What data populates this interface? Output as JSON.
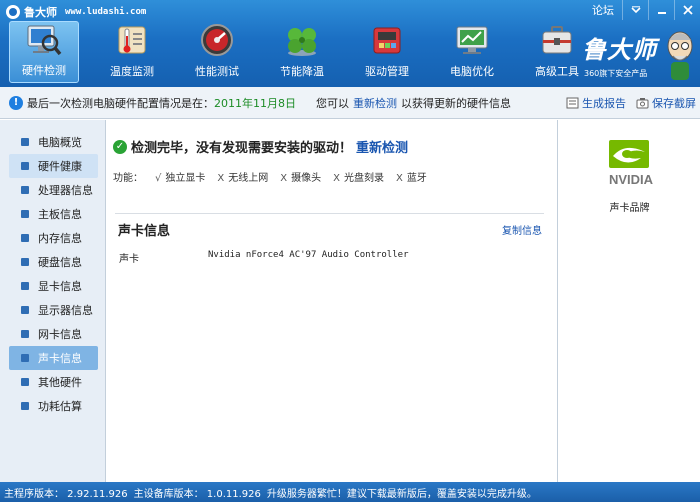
{
  "window": {
    "app_name": "鲁大师",
    "url": "www.ludashi.com",
    "forum_label": "论坛"
  },
  "toolbar": {
    "items": [
      {
        "label": "硬件检测",
        "icon": "hardware-detect-icon"
      },
      {
        "label": "温度监测",
        "icon": "thermometer-icon"
      },
      {
        "label": "性能测试",
        "icon": "speedometer-icon"
      },
      {
        "label": "节能降温",
        "icon": "clover-icon"
      },
      {
        "label": "驱动管理",
        "icon": "driver-toolbox-icon"
      },
      {
        "label": "电脑优化",
        "icon": "monitor-optimize-icon"
      },
      {
        "label": "高级工具",
        "icon": "tools-case-icon"
      }
    ],
    "active_index": 0
  },
  "brand": {
    "title": "鲁大师",
    "subtitle": "360旗下安全产品"
  },
  "infobar": {
    "text_prefix": "最后一次检测电脑硬件配置情况是在：",
    "date": "2011年11月8日",
    "text_mid": "您可以",
    "redetect_link": "重新检测",
    "text_suffix": "以获得更新的硬件信息",
    "report_label": "生成报告",
    "screenshot_label": "保存截屏"
  },
  "sidebar": {
    "items": [
      {
        "label": "电脑概览"
      },
      {
        "label": "硬件健康"
      },
      {
        "label": "处理器信息"
      },
      {
        "label": "主板信息"
      },
      {
        "label": "内存信息"
      },
      {
        "label": "硬盘信息"
      },
      {
        "label": "显卡信息"
      },
      {
        "label": "显示器信息"
      },
      {
        "label": "网卡信息"
      },
      {
        "label": "声卡信息"
      },
      {
        "label": "其他硬件"
      },
      {
        "label": "功耗估算"
      }
    ],
    "highlight_index": 1,
    "active_index": 9
  },
  "main": {
    "status_text": "检测完毕，没有发现需要安装的驱动！",
    "redetect_link": "重新检测",
    "features_label": "功能：",
    "features": [
      {
        "mark": "√",
        "label": "独立显卡"
      },
      {
        "mark": "X",
        "label": "无线上网"
      },
      {
        "mark": "X",
        "label": "摄像头"
      },
      {
        "mark": "X",
        "label": "光盘刻录"
      },
      {
        "mark": "X",
        "label": "蓝牙"
      }
    ],
    "section_title": "声卡信息",
    "copy_link": "复制信息",
    "sound_label": "声卡",
    "sound_value": "Nvidia nForce4 AC'97 Audio Controller"
  },
  "brandpanel": {
    "logo_text": "NVIDIA",
    "label": "声卡品牌"
  },
  "statusbar": {
    "main_version": "主程序版本： 2.92.11.926",
    "db_version": "主设备库版本： 1.0.11.926",
    "message": "升级服务器繁忙！建议下载最新版后，覆盖安装以完成升级。"
  },
  "colors": {
    "titlebar_blue": "#1b6fc3",
    "link_blue": "#1a56b0",
    "date_green": "#1c8c26",
    "ok_green": "#2aa335",
    "sidebar_active": "#7fb4e4"
  }
}
